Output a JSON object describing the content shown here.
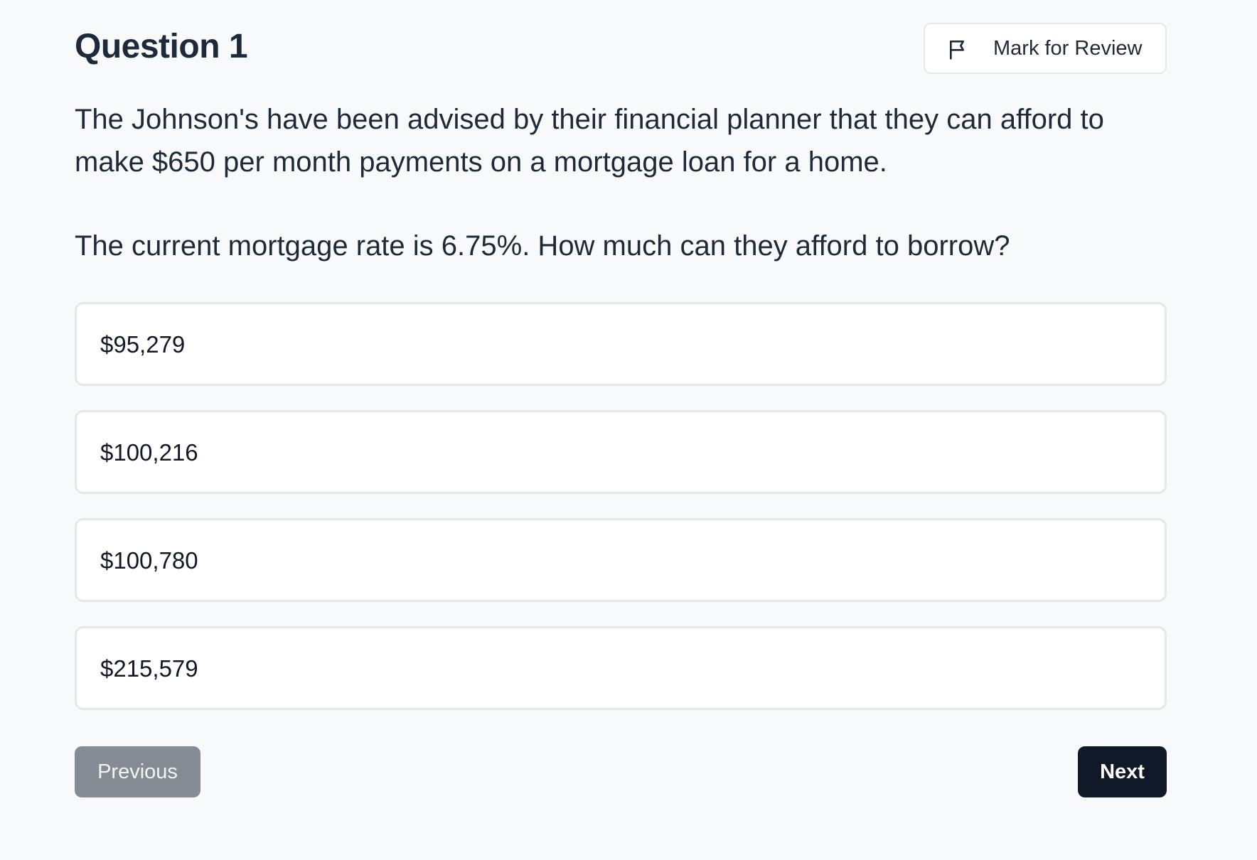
{
  "question": {
    "title": "Question 1",
    "prompt_line_1": "The Johnson's have been advised by their financial planner that they can afford to make $650 per month payments on a mortgage loan for a home.",
    "prompt_line_2": "The current mortgage rate is 6.75%. How much can they afford to borrow?"
  },
  "review": {
    "label": "Mark for Review",
    "icon": "flag-icon"
  },
  "options": [
    {
      "label": "$95,279"
    },
    {
      "label": "$100,216"
    },
    {
      "label": "$100,780"
    },
    {
      "label": "$215,579"
    }
  ],
  "navigation": {
    "previous_label": "Previous",
    "next_label": "Next"
  },
  "colors": {
    "background": "#f8f9fb",
    "text": "#1f2937",
    "option_border": "#e5e7eb",
    "previous_bg": "#878b94",
    "next_bg": "#111827"
  }
}
